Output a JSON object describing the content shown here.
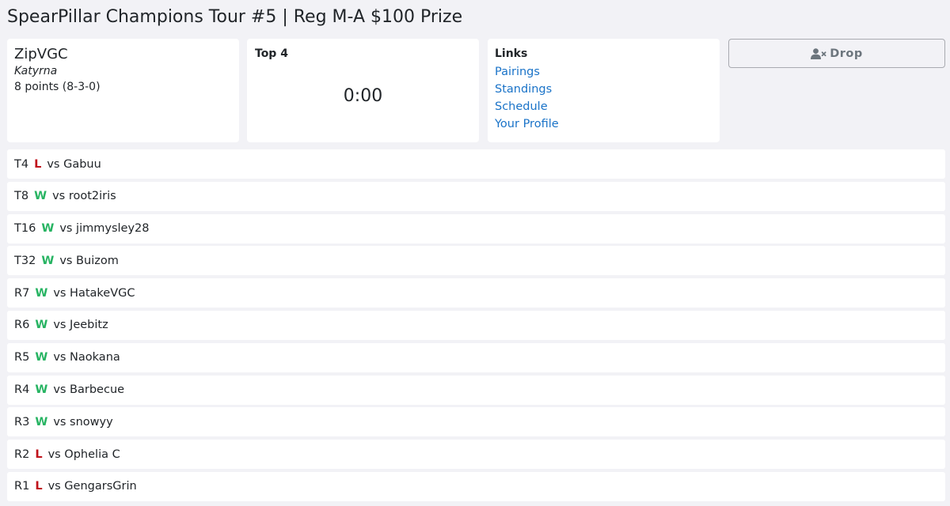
{
  "page_title": "SpearPillar Champions Tour #5 | Reg M-A $100 Prize",
  "player": {
    "name": "ZipVGC",
    "team": "Katyrna",
    "record": "8 points (8-3-0)"
  },
  "timer": {
    "heading": "Top 4",
    "value": "0:00"
  },
  "links": {
    "heading": "Links",
    "items": [
      "Pairings",
      "Standings",
      "Schedule",
      "Your Profile"
    ]
  },
  "drop_button": {
    "label": "Drop",
    "icon": "user-times-icon",
    "color": "#6c757d"
  },
  "colors": {
    "win": "#28b463",
    "loss": "#c0121b",
    "link": "#1a73c8",
    "background": "#f2f2f6"
  },
  "matches": [
    {
      "round": "T4",
      "result": "L",
      "opponent": "vs Gabuu"
    },
    {
      "round": "T8",
      "result": "W",
      "opponent": "vs root2iris"
    },
    {
      "round": "T16",
      "result": "W",
      "opponent": "vs jimmysley28"
    },
    {
      "round": "T32",
      "result": "W",
      "opponent": "vs Buizom"
    },
    {
      "round": "R7",
      "result": "W",
      "opponent": "vs HatakeVGC"
    },
    {
      "round": "R6",
      "result": "W",
      "opponent": "vs Jeebitz"
    },
    {
      "round": "R5",
      "result": "W",
      "opponent": "vs Naokana"
    },
    {
      "round": "R4",
      "result": "W",
      "opponent": "vs Barbecue"
    },
    {
      "round": "R3",
      "result": "W",
      "opponent": "vs snowyy"
    },
    {
      "round": "R2",
      "result": "L",
      "opponent": "vs Ophelia C"
    },
    {
      "round": "R1",
      "result": "L",
      "opponent": "vs GengarsGrin"
    }
  ]
}
